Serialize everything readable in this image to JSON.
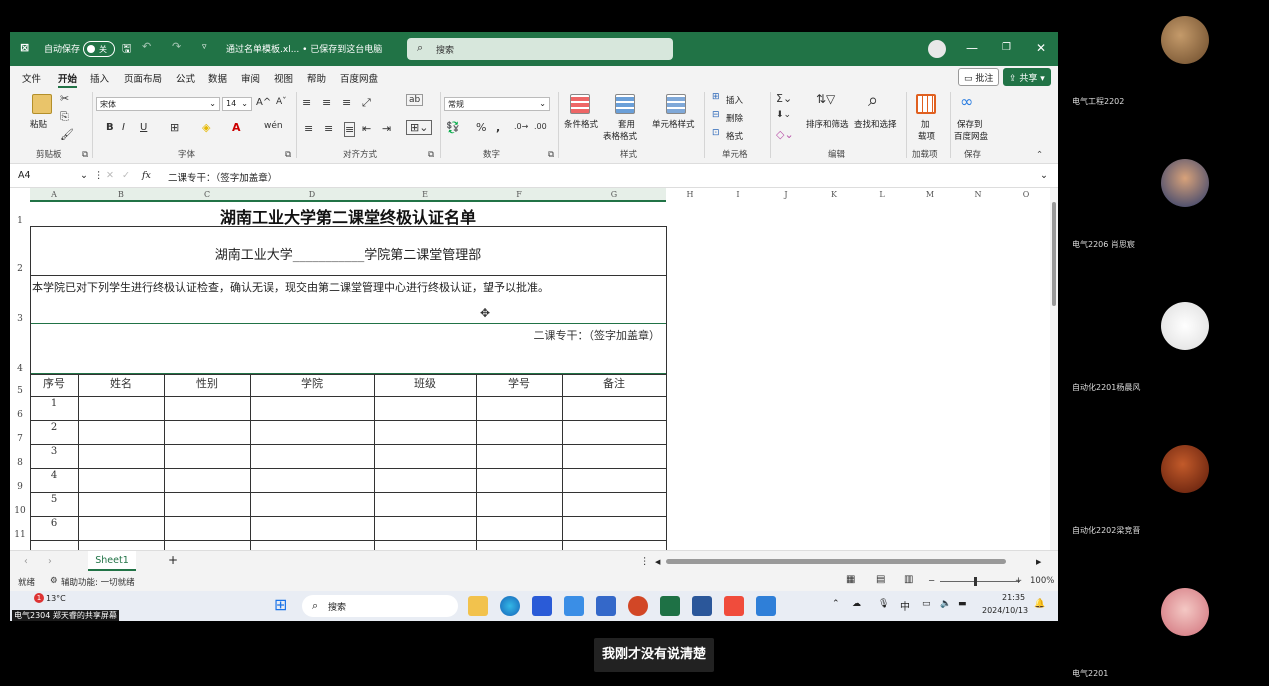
{
  "titlebar": {
    "autosave_label": "自动保存",
    "autosave_state": "关",
    "filename": "通过名单模板.xl... • 已保存到这台电脑",
    "search_placeholder": "搜索"
  },
  "menu": {
    "items": [
      "文件",
      "开始",
      "插入",
      "页面布局",
      "公式",
      "数据",
      "审阅",
      "视图",
      "帮助",
      "百度网盘"
    ],
    "active": "开始",
    "comment_btn": "批注",
    "share_btn": "共享"
  },
  "ribbon": {
    "paste": "粘贴",
    "font_name": "宋体",
    "font_size": "14",
    "number_format": "常规",
    "cond_format": "条件格式",
    "table_format_1": "套用",
    "table_format_2": "表格格式",
    "cell_style": "单元格样式",
    "insert": "插入",
    "delete": "删除",
    "format": "格式",
    "sort_filter": "排序和筛选",
    "find_select": "查找和选择",
    "addin_1": "加",
    "addin_2": "载项",
    "baidu_1": "保存到",
    "baidu_2": "百度网盘",
    "groups": {
      "clipboard": "剪贴板",
      "font": "字体",
      "alignment": "对齐方式",
      "number": "数字",
      "styles": "样式",
      "cells": "单元格",
      "editing": "编辑",
      "addins": "加载项",
      "save": "保存"
    }
  },
  "formula_bar": {
    "cell_ref": "A4",
    "fx": "fx",
    "content": "二课专干：（签字加盖章）"
  },
  "sheet": {
    "columns": [
      "A",
      "B",
      "C",
      "D",
      "E",
      "F",
      "G",
      "H",
      "I",
      "J",
      "K",
      "L",
      "M",
      "N",
      "O"
    ],
    "rows": [
      "1",
      "2",
      "3",
      "4",
      "5",
      "6",
      "7",
      "8",
      "9",
      "10",
      "11"
    ],
    "title": "湖南工业大学第二课堂终极认证名单",
    "subtitle_prefix": "湖南工业大学",
    "subtitle_blank": "___________",
    "subtitle_suffix": "学院第二课堂管理部",
    "statement": "本学院已对下列学生进行终极认证检查，确认无误，现交由第二课堂管理中心进行终极认证，望予以批准。",
    "signature": "二课专干：（签字加盖章）",
    "table_headers": [
      "序号",
      "姓名",
      "性别",
      "学院",
      "班级",
      "学号",
      "备注"
    ],
    "serials": [
      "1",
      "2",
      "3",
      "4",
      "5",
      "6"
    ]
  },
  "tabs": {
    "sheet": "Sheet1",
    "add": "+"
  },
  "status": {
    "ready": "就绪",
    "accessibility": "辅助功能: 一切就绪",
    "zoom": "100%"
  },
  "taskbar": {
    "temp": "13°C",
    "notify": "1",
    "search": "搜索",
    "ime": "中",
    "time": "21:35",
    "date": "2024/10/13",
    "share_note": "电气2304 郑天睿的共享屏幕"
  },
  "participants": [
    "电气工程2202",
    "电气2206 肖思宸",
    "自动化2201杨晨风",
    "自动化2202梁竞晋",
    "电气2201"
  ],
  "caption": "我刚才没有说清楚"
}
